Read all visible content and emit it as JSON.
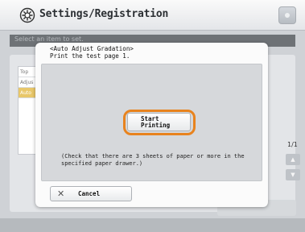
{
  "header": {
    "title": "Settings/Registration",
    "icon": "gear-icon"
  },
  "background": {
    "subtitle": "Select an item to set.",
    "list_items": [
      "Top",
      "Adjus",
      "Auto"
    ],
    "page_indicator": "1/1"
  },
  "dialog": {
    "heading": "<Auto Adjust Gradation>",
    "instruction": "Print the test page 1.",
    "start_button": "Start\nPrinting",
    "note": "(Check that there are 3 sheets of paper or more in the specified paper drawer.)",
    "cancel_label": "Cancel",
    "accent_color": "#e8831e"
  }
}
